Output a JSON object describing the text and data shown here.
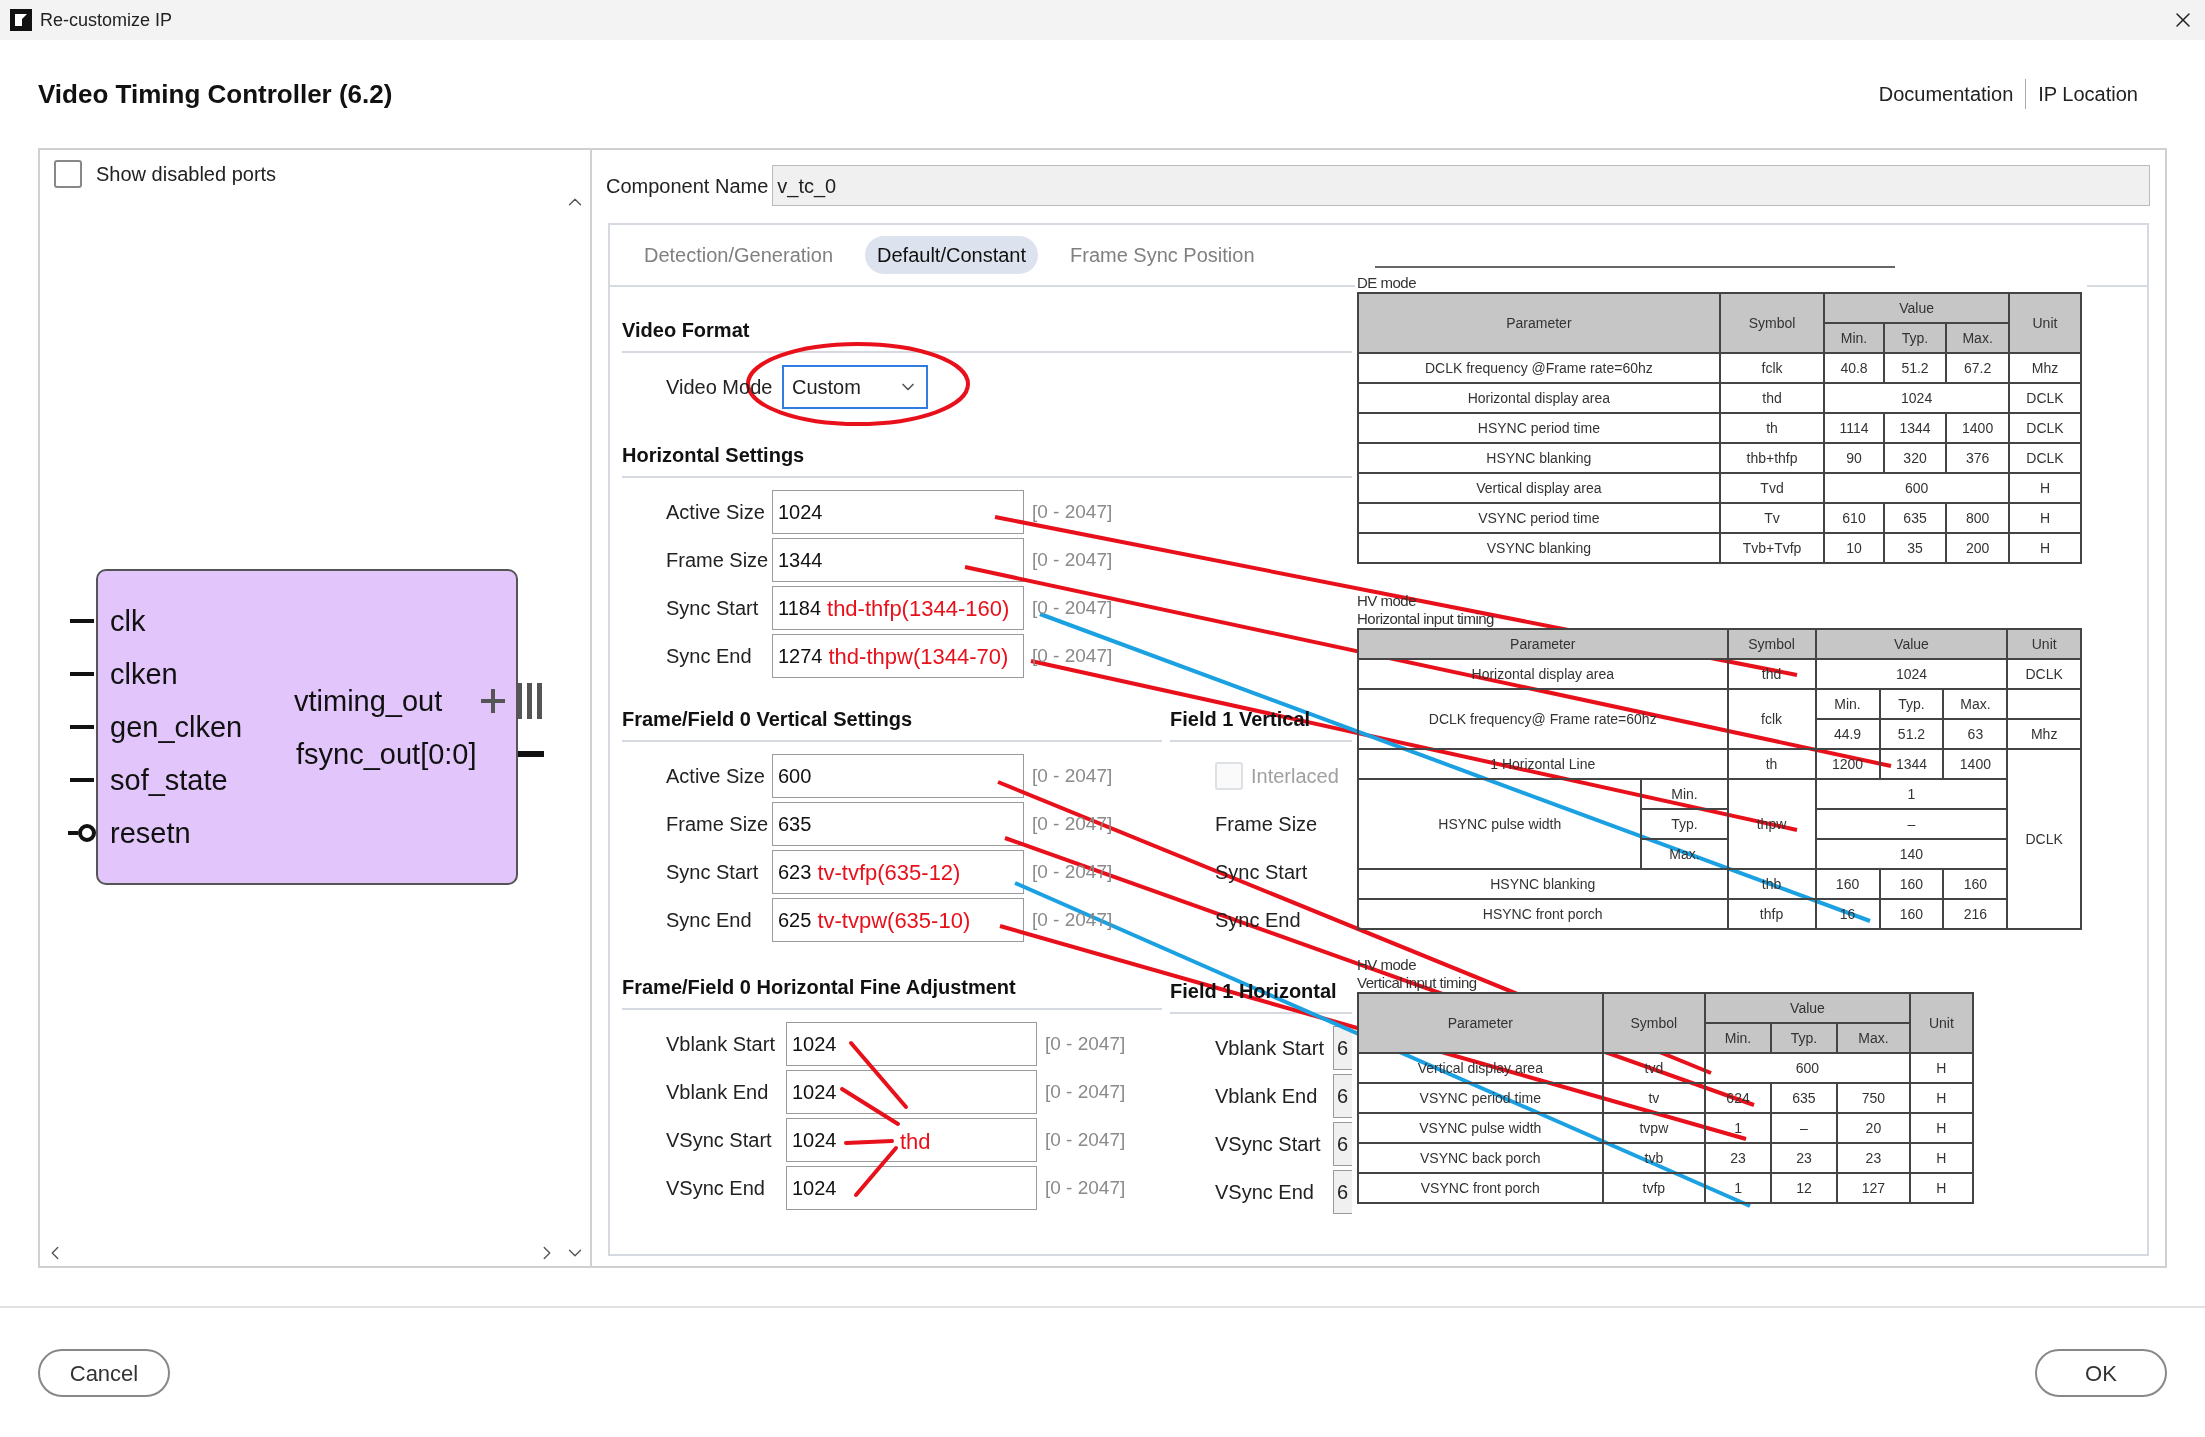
{
  "window": {
    "title": "Re-customize IP"
  },
  "header": {
    "title": "Video Timing Controller (6.2)",
    "links": [
      "Documentation",
      "IP Location"
    ]
  },
  "left_panel": {
    "show_disabled_ports": {
      "label": "Show disabled ports",
      "checked": false
    },
    "inputs": [
      {
        "name": "clk",
        "kind": "plain"
      },
      {
        "name": "clken",
        "kind": "plain"
      },
      {
        "name": "gen_clken",
        "kind": "plain"
      },
      {
        "name": "sof_state",
        "kind": "plain"
      },
      {
        "name": "resetn",
        "kind": "inverted"
      }
    ],
    "outputs": [
      {
        "name": "vtiming_out",
        "kind": "bus"
      },
      {
        "name": "fsync_out[0:0]",
        "kind": "wire"
      }
    ]
  },
  "component_name": {
    "label": "Component Name",
    "value": "v_tc_0"
  },
  "tabs": [
    {
      "label": "Detection/Generation",
      "selected": false
    },
    {
      "label": "Default/Constant",
      "selected": true
    },
    {
      "label": "Frame Sync Position",
      "selected": false
    }
  ],
  "video_format": {
    "title": "Video Format",
    "video_mode": {
      "label": "Video Mode",
      "value": "Custom"
    }
  },
  "horizontal_settings": {
    "title": "Horizontal Settings",
    "rows": [
      {
        "label": "Active Size",
        "value": "1024",
        "range": "[0 - 2047]"
      },
      {
        "label": "Frame Size",
        "value": "1344",
        "range": "[0 - 2047]"
      },
      {
        "label": "Sync Start",
        "value": "1184",
        "note": "thd-thfp(1344-160)",
        "range": "[0 - 2047]"
      },
      {
        "label": "Sync End",
        "value": "1274",
        "note": "thd-thpw(1344-70)",
        "range": "[0 - 2047]"
      }
    ]
  },
  "vertical_settings": {
    "title": "Frame/Field 0 Vertical Settings",
    "rows": [
      {
        "label": "Active Size",
        "value": "600",
        "range": "[0 - 2047]"
      },
      {
        "label": "Frame Size",
        "value": "635",
        "range": "[0 - 2047]"
      },
      {
        "label": "Sync Start",
        "value": "623",
        "note": "tv-tvfp(635-12)",
        "range": "[0 - 2047]"
      },
      {
        "label": "Sync End",
        "value": "625",
        "note": "tv-tvpw(635-10)",
        "range": "[0 - 2047]"
      }
    ]
  },
  "fine_adjustment": {
    "title": "Frame/Field 0 Horizontal Fine Adjustment",
    "rows": [
      {
        "label": "Vblank Start",
        "value": "1024",
        "range": "[0 - 2047]"
      },
      {
        "label": "Vblank End",
        "value": "1024",
        "range": "[0 - 2047]"
      },
      {
        "label": "VSync Start",
        "value": "1024",
        "range": "[0 - 2047]"
      },
      {
        "label": "VSync End",
        "value": "1024",
        "range": "[0 - 2047]"
      }
    ]
  },
  "field1_vertical": {
    "title": "Field 1 Vertical",
    "interlaced": {
      "label": "Interlaced",
      "checked": false,
      "disabled": true
    },
    "labels": [
      "Frame Size",
      "Sync Start",
      "Sync End"
    ]
  },
  "field1_horizontal": {
    "title": "Field 1 Horizontal",
    "rows": [
      {
        "label": "Vblank Start",
        "value": "6"
      },
      {
        "label": "Vblank End",
        "value": "6"
      },
      {
        "label": "VSync Start",
        "value": "6"
      },
      {
        "label": "VSync End",
        "value": "6"
      }
    ]
  },
  "datasheet": {
    "tables": [
      {
        "captions": [
          "DE mode"
        ],
        "rows": [
          {
            "kind": "header",
            "cells": [
              {
                "text": "Parameter",
                "rowspan": 2
              },
              {
                "text": "Symbol",
                "rowspan": 2
              },
              {
                "text": "Value",
                "colspan": 3
              },
              {
                "text": "Unit",
                "rowspan": 2
              }
            ]
          },
          {
            "kind": "header",
            "cells": [
              {
                "text": "Min."
              },
              {
                "text": "Typ."
              },
              {
                "text": "Max."
              }
            ]
          },
          {
            "kind": "data",
            "cells": [
              {
                "text": "DCLK frequency @Frame rate=60hz"
              },
              {
                "text": "fclk"
              },
              {
                "text": "40.8"
              },
              {
                "text": "51.2"
              },
              {
                "text": "67.2"
              },
              {
                "text": "Mhz"
              }
            ]
          },
          {
            "kind": "data",
            "cells": [
              {
                "text": "Horizontal display area"
              },
              {
                "text": "thd"
              },
              {
                "text": "1024",
                "colspan": 3
              },
              {
                "text": "DCLK"
              }
            ]
          },
          {
            "kind": "data",
            "cells": [
              {
                "text": "HSYNC period time"
              },
              {
                "text": "th"
              },
              {
                "text": "1114"
              },
              {
                "text": "1344"
              },
              {
                "text": "1400"
              },
              {
                "text": "DCLK"
              }
            ]
          },
          {
            "kind": "data",
            "cells": [
              {
                "text": "HSYNC blanking"
              },
              {
                "text": "thb+thfp"
              },
              {
                "text": "90"
              },
              {
                "text": "320"
              },
              {
                "text": "376"
              },
              {
                "text": "DCLK"
              }
            ]
          },
          {
            "kind": "data",
            "cells": [
              {
                "text": "Vertical display area"
              },
              {
                "text": "Tvd"
              },
              {
                "text": "600",
                "colspan": 3
              },
              {
                "text": "H"
              }
            ]
          },
          {
            "kind": "data",
            "cells": [
              {
                "text": "VSYNC period time"
              },
              {
                "text": "Tv"
              },
              {
                "text": "610"
              },
              {
                "text": "635"
              },
              {
                "text": "800"
              },
              {
                "text": "H"
              }
            ]
          },
          {
            "kind": "data",
            "cells": [
              {
                "text": "VSYNC blanking"
              },
              {
                "text": "Tvb+Tvfp"
              },
              {
                "text": "10"
              },
              {
                "text": "35"
              },
              {
                "text": "200"
              },
              {
                "text": "H"
              }
            ]
          }
        ]
      },
      {
        "captions": [
          "HV mode",
          "Horizontal input timing"
        ],
        "rows": [
          {
            "kind": "header",
            "cells": [
              {
                "text": "Parameter",
                "colspan": 2
              },
              {
                "text": "Symbol"
              },
              {
                "text": "Value",
                "colspan": 3
              },
              {
                "text": "Unit"
              }
            ]
          },
          {
            "kind": "data",
            "cells": [
              {
                "text": "Horizontal display area",
                "colspan": 2
              },
              {
                "text": "thd"
              },
              {
                "text": "1024",
                "colspan": 3
              },
              {
                "text": "DCLK"
              }
            ]
          },
          {
            "kind": "data",
            "cells": [
              {
                "text": "DCLK frequency@ Frame rate=60hz",
                "colspan": 2,
                "rowspan": 2
              },
              {
                "text": "fclk",
                "rowspan": 2
              },
              {
                "text": "Min."
              },
              {
                "text": "Typ."
              },
              {
                "text": "Max."
              }
            ]
          },
          {
            "kind": "data",
            "cells": [
              {
                "text": "44.9"
              },
              {
                "text": "51.2"
              },
              {
                "text": "63"
              },
              {
                "text": "Mhz"
              }
            ]
          },
          {
            "kind": "data",
            "cells": [
              {
                "text": "1 Horizontal Line",
                "colspan": 2
              },
              {
                "text": "th"
              },
              {
                "text": "1200"
              },
              {
                "text": "1344"
              },
              {
                "text": "1400"
              },
              {
                "text": "DCLK",
                "rowspan": 6
              }
            ]
          },
          {
            "kind": "data",
            "cells": [
              {
                "text": "HSYNC pulse width",
                "rowspan": 3
              },
              {
                "text": "Min."
              },
              {
                "text": "thpw",
                "rowspan": 3
              },
              {
                "text": "1",
                "colspan": 3
              }
            ]
          },
          {
            "kind": "data",
            "cells": [
              {
                "text": "Typ."
              },
              {
                "text": "–",
                "colspan": 3
              }
            ]
          },
          {
            "kind": "data",
            "cells": [
              {
                "text": "Max."
              },
              {
                "text": "140",
                "colspan": 3
              }
            ]
          },
          {
            "kind": "data",
            "cells": [
              {
                "text": "HSYNC blanking",
                "colspan": 2
              },
              {
                "text": "thb"
              },
              {
                "text": "160"
              },
              {
                "text": "160"
              },
              {
                "text": "160"
              }
            ]
          },
          {
            "kind": "data",
            "cells": [
              {
                "text": "HSYNC front porch",
                "colspan": 2
              },
              {
                "text": "thfp"
              },
              {
                "text": "16"
              },
              {
                "text": "160"
              },
              {
                "text": "216"
              }
            ]
          }
        ]
      },
      {
        "captions": [
          "HV mode",
          "Vertical input timing"
        ],
        "rows": [
          {
            "kind": "header",
            "cells": [
              {
                "text": "Parameter",
                "rowspan": 2
              },
              {
                "text": "Symbol",
                "rowspan": 2
              },
              {
                "text": "Value",
                "colspan": 3
              },
              {
                "text": "Unit",
                "rowspan": 2
              }
            ]
          },
          {
            "kind": "header",
            "cells": [
              {
                "text": "Min."
              },
              {
                "text": "Typ."
              },
              {
                "text": "Max."
              }
            ]
          },
          {
            "kind": "data",
            "cells": [
              {
                "text": "Vertical display area"
              },
              {
                "text": "tvd"
              },
              {
                "text": "600",
                "colspan": 3
              },
              {
                "text": "H"
              }
            ]
          },
          {
            "kind": "data",
            "cells": [
              {
                "text": "VSYNC period time"
              },
              {
                "text": "tv"
              },
              {
                "text": "624"
              },
              {
                "text": "635"
              },
              {
                "text": "750"
              },
              {
                "text": "H"
              }
            ]
          },
          {
            "kind": "data",
            "cells": [
              {
                "text": "VSYNC pulse width"
              },
              {
                "text": "tvpw"
              },
              {
                "text": "1"
              },
              {
                "text": "–"
              },
              {
                "text": "20"
              },
              {
                "text": "H"
              }
            ]
          },
          {
            "kind": "data",
            "cells": [
              {
                "text": "VSYNC back porch"
              },
              {
                "text": "tvb"
              },
              {
                "text": "23"
              },
              {
                "text": "23"
              },
              {
                "text": "23"
              },
              {
                "text": "H"
              }
            ]
          },
          {
            "kind": "data",
            "cells": [
              {
                "text": "VSYNC front porch"
              },
              {
                "text": "tvfp"
              },
              {
                "text": "1"
              },
              {
                "text": "12"
              },
              {
                "text": "127"
              },
              {
                "text": "H"
              }
            ]
          }
        ]
      }
    ]
  },
  "annotation": {
    "label": "thd"
  },
  "buttons": [
    "Cancel",
    "OK"
  ]
}
